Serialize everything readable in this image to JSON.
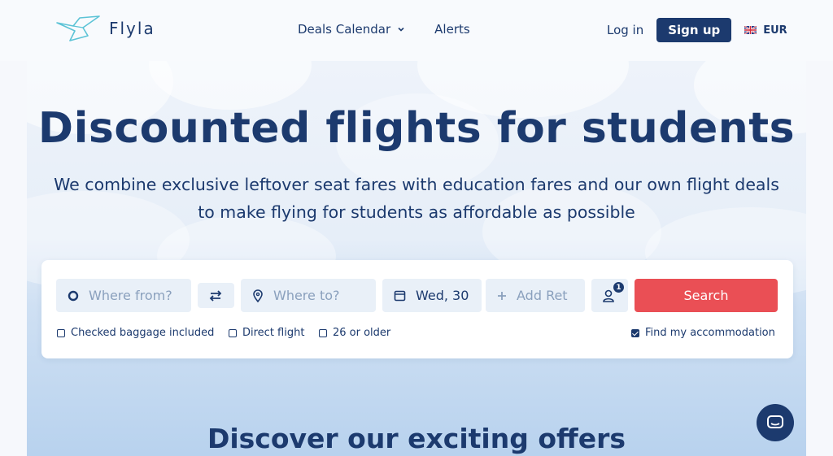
{
  "header": {
    "logo_text": "Flyla",
    "nav": [
      {
        "label": "Deals Calendar",
        "icon": "chevron-down-icon"
      },
      {
        "label": "Alerts"
      }
    ],
    "login_label": "Log in",
    "signup_label": "Sign up",
    "currency": "EUR",
    "flag_icon": "uk-flag-icon"
  },
  "hero": {
    "title": "Discounted flights for students",
    "subtitle_line1": "We combine exclusive leftover seat fares with education fares and our own flight deals",
    "subtitle_line2": "to make flying for students as affordable as possible"
  },
  "search": {
    "from_placeholder": "Where from?",
    "to_placeholder": "Where to?",
    "depart_value": "Wed, 30",
    "return_placeholder": "Add Ret",
    "passenger_count": "1",
    "search_label": "Search",
    "options": [
      {
        "label": "Checked baggage included",
        "checked": false
      },
      {
        "label": "Direct flight",
        "checked": false
      },
      {
        "label": "26 or older",
        "checked": false
      },
      {
        "label": "Find my accommodation",
        "checked": true
      }
    ]
  },
  "discover_title": "Discover our exciting offers",
  "colors": {
    "brand": "#1c3a6e",
    "accent": "#ea4f55",
    "field_bg": "#e9f0f8"
  }
}
